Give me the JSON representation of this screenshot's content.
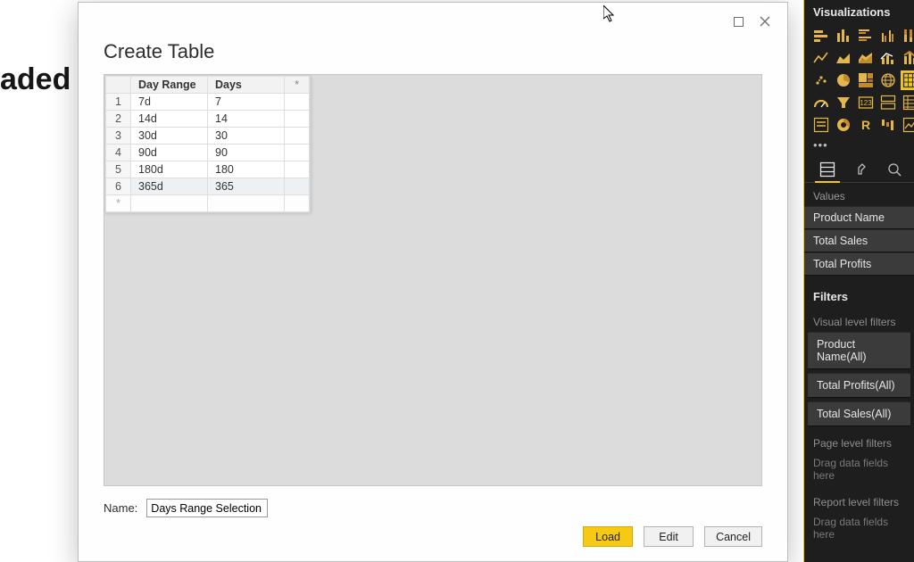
{
  "bg_title": "aded I",
  "dialog": {
    "title": "Create Table",
    "expand_marker": "*",
    "columns": [
      "Day Range",
      "Days"
    ],
    "rows": [
      {
        "n": 1,
        "day_range": "7d",
        "days": "7"
      },
      {
        "n": 2,
        "day_range": "14d",
        "days": "14"
      },
      {
        "n": 3,
        "day_range": "30d",
        "days": "30"
      },
      {
        "n": 4,
        "day_range": "90d",
        "days": "90"
      },
      {
        "n": 5,
        "day_range": "180d",
        "days": "180"
      },
      {
        "n": 6,
        "day_range": "365d",
        "days": "365"
      }
    ],
    "blank_marker": "*",
    "name_label": "Name:",
    "name_value": "Days Range Selection",
    "buttons": {
      "load": "Load",
      "edit": "Edit",
      "cancel": "Cancel"
    }
  },
  "vis": {
    "title": "Visualizations",
    "sections": {
      "values": "Values",
      "filters": "Filters",
      "visual_filters": "Visual level filters",
      "page_filters": "Page level filters",
      "report_filters": "Report level filters",
      "drag_hint": "Drag data fields here"
    },
    "value_fields": [
      "Product Name",
      "Total Sales",
      "Total Profits"
    ],
    "filter_items": [
      "Product Name(All)",
      "Total Profits(All)",
      "Total Sales(All)"
    ]
  }
}
